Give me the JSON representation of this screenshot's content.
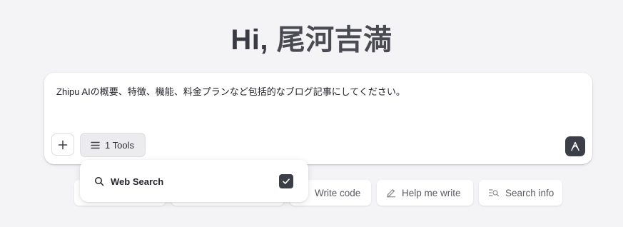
{
  "greeting": {
    "prefix": "Hi, ",
    "name": "尾河吉満"
  },
  "composer": {
    "prompt_text": "Zhipu AIの概要、特徴、機能、料金プランなど包括的なブログ記事にしてください。",
    "add_icon": "plus-icon",
    "tools_button": {
      "icon": "menu-icon",
      "label": "1 Tools"
    },
    "send_icon": "send-arrow-icon"
  },
  "tools_menu": {
    "items": [
      {
        "icon": "search-icon",
        "label": "Web Search",
        "checked": true
      }
    ]
  },
  "suggestions": [
    {
      "icon": "code-icon",
      "label": "Write code"
    },
    {
      "icon": "pen-icon",
      "label": "Help me write"
    },
    {
      "icon": "search-info-icon",
      "label": "Search info"
    }
  ],
  "colors": {
    "background": "#f4f4f6",
    "surface": "#ffffff",
    "accent_dark": "#3d3f48",
    "text_primary": "#2b2c33",
    "text_muted": "#5a5b62"
  }
}
